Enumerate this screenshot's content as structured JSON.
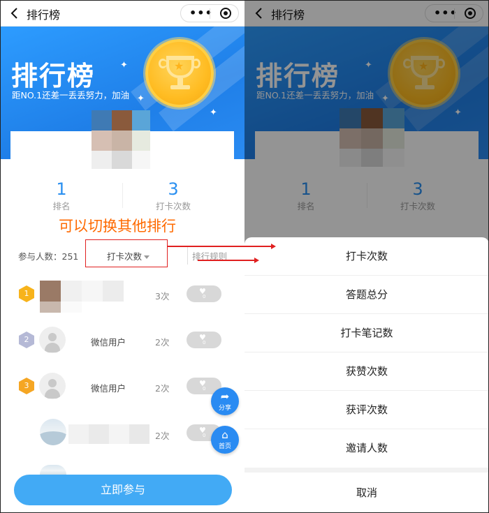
{
  "nav": {
    "title": "排行榜",
    "menu_glyph": "•••"
  },
  "banner": {
    "title": "排行榜",
    "subtitle": "距NO.1还差一丢丢努力，加油",
    "medal_icon": "trophy-icon"
  },
  "stats": {
    "rank_value": "1",
    "rank_label": "排名",
    "checkin_value": "3",
    "checkin_label": "打卡次数"
  },
  "annotation": "可以切换其他排行",
  "controls": {
    "participants": "参与人数：251",
    "sort_selected": "打卡次数",
    "rules_link": "排行规则"
  },
  "rankings": [
    {
      "rank": "1",
      "name": "",
      "times": "3次",
      "likes": "0"
    },
    {
      "rank": "2",
      "name": "微信用户",
      "times": "2次",
      "likes": "0"
    },
    {
      "rank": "3",
      "name": "微信用户",
      "times": "2次",
      "likes": "0"
    },
    {
      "rank": "",
      "name": "",
      "times": "2次",
      "likes": "0"
    }
  ],
  "fabs": {
    "share_label": "分享",
    "home_label": "首页"
  },
  "join_button": "立即参与",
  "sheet": {
    "options": [
      "打卡次数",
      "答题总分",
      "打卡笔记数",
      "获赞次数",
      "获评次数",
      "邀请人数"
    ],
    "cancel": "取消"
  },
  "colors": {
    "brand_blue": "#2a8bf2",
    "accent_orange": "#ff6a00",
    "annotation_red": "#e02020",
    "medal_gold": "#ffbc22"
  }
}
